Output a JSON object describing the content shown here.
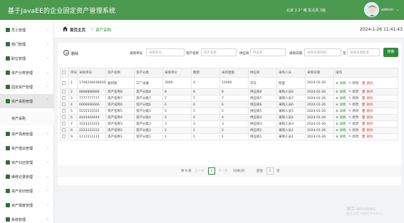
{
  "header": {
    "title": "基于JavaEE的企业固定资产管理系统",
    "weather": "北京 2.2° 晴 东北风 3级",
    "user_name": "admin",
    "user_caret": "⌄",
    "bg_color": "#4c9a4f"
  },
  "sidebar": {
    "items": [
      {
        "label": "员工管理",
        "chevron": "⌄"
      },
      {
        "label": "部门管理",
        "chevron": "⌄"
      },
      {
        "label": "职位管理",
        "chevron": "⌄"
      },
      {
        "label": "资产分类管理",
        "chevron": "⌄"
      },
      {
        "label": "固定资产管理",
        "chevron": "⌄"
      },
      {
        "label": "资产采购管理",
        "chevron": "⌃"
      },
      {
        "label": "资产领用管理",
        "chevron": "⌄"
      },
      {
        "label": "资产借出管理",
        "chevron": "⌄"
      },
      {
        "label": "资产归还管理",
        "chevron": "⌄"
      },
      {
        "label": "维修记录管理",
        "chevron": "⌄"
      },
      {
        "label": "资产折旧管理",
        "chevron": "⌄"
      },
      {
        "label": "资产报废管理",
        "chevron": "⌄"
      },
      {
        "label": "系统管理",
        "chevron": "⌄"
      }
    ],
    "sub_item": "资产采购"
  },
  "breadcrumb": {
    "home": "首页主页",
    "separator": "▷",
    "current": "资产采购"
  },
  "datetime": "2024-1-26 11:41:43",
  "toolbar": {
    "delete_label": "删除",
    "filters": [
      {
        "label": "采购单号",
        "placeholder": "采购单号"
      },
      {
        "label": "资产名称",
        "placeholder": "资产名称"
      },
      {
        "label": "供应商",
        "placeholder": "供应商"
      },
      {
        "label": "采购日期",
        "placeholder": "采购日期开始"
      },
      {
        "label": "至",
        "placeholder": "采购日期结束"
      }
    ],
    "search_label": "搜索"
  },
  "table": {
    "headers": [
      "",
      "序号",
      "采购单号",
      "资产名称",
      "资产分类",
      "采购单价",
      "数量",
      "采购金额",
      "供应商",
      "采购人员",
      "采购日期",
      "操作"
    ],
    "rows": [
      [
        "1",
        "1706249438026",
        "复印机",
        "工厂设备",
        "3000",
        "4",
        "12000",
        "京东",
        "阿里",
        "2024-01-26"
      ],
      [
        "2",
        "8888888888",
        "资产名称8",
        "资产分类8",
        "8",
        "8",
        "8",
        "供应商8",
        "采购人员8",
        "2024-01-26"
      ],
      [
        "3",
        "7777777777",
        "资产名称7",
        "资产分类7",
        "7",
        "7",
        "7",
        "供应商7",
        "采购人员7",
        "2024-01-26"
      ],
      [
        "4",
        "6666666666",
        "资产名称6",
        "资产分类6",
        "6",
        "6",
        "6",
        "供应商6",
        "采购人员6",
        "2024-01-26"
      ],
      [
        "5",
        "5555555555",
        "资产名称5",
        "资产分类5",
        "5",
        "5",
        "5",
        "供应商5",
        "采购人员5",
        "2024-01-26"
      ],
      [
        "6",
        "4444444444",
        "资产名称4",
        "资产分类4",
        "4",
        "4",
        "4",
        "供应商4",
        "采购人员4",
        "2024-01-26"
      ],
      [
        "7",
        "3333333333",
        "资产名称3",
        "资产分类3",
        "3",
        "3",
        "3",
        "供应商3",
        "采购人员3",
        "2024-01-26"
      ],
      [
        "8",
        "2222222222",
        "资产名称2",
        "资产分类2",
        "2",
        "2",
        "2",
        "供应商2",
        "采购人员2",
        "2024-01-26"
      ],
      [
        "9",
        "1111111111",
        "资产名称1",
        "资产分类1",
        "1",
        "1",
        "1",
        "供应商1",
        "采购人员1",
        "2024-01-26"
      ]
    ],
    "ops": {
      "detail": "⊕ 详情",
      "edit": "✎ 修改",
      "delete": "🗑 删除"
    }
  },
  "pagination": {
    "total": "共 9 条",
    "prev": "上一页",
    "page": "1",
    "next": "下一页",
    "per_page": "10条/页",
    "goto_label": "前往",
    "goto_value": "1",
    "goto_unit": "页"
  },
  "watermark": {
    "title": "激活 Windows",
    "subtitle": "转到\"设置\"以激活 Windows。"
  }
}
